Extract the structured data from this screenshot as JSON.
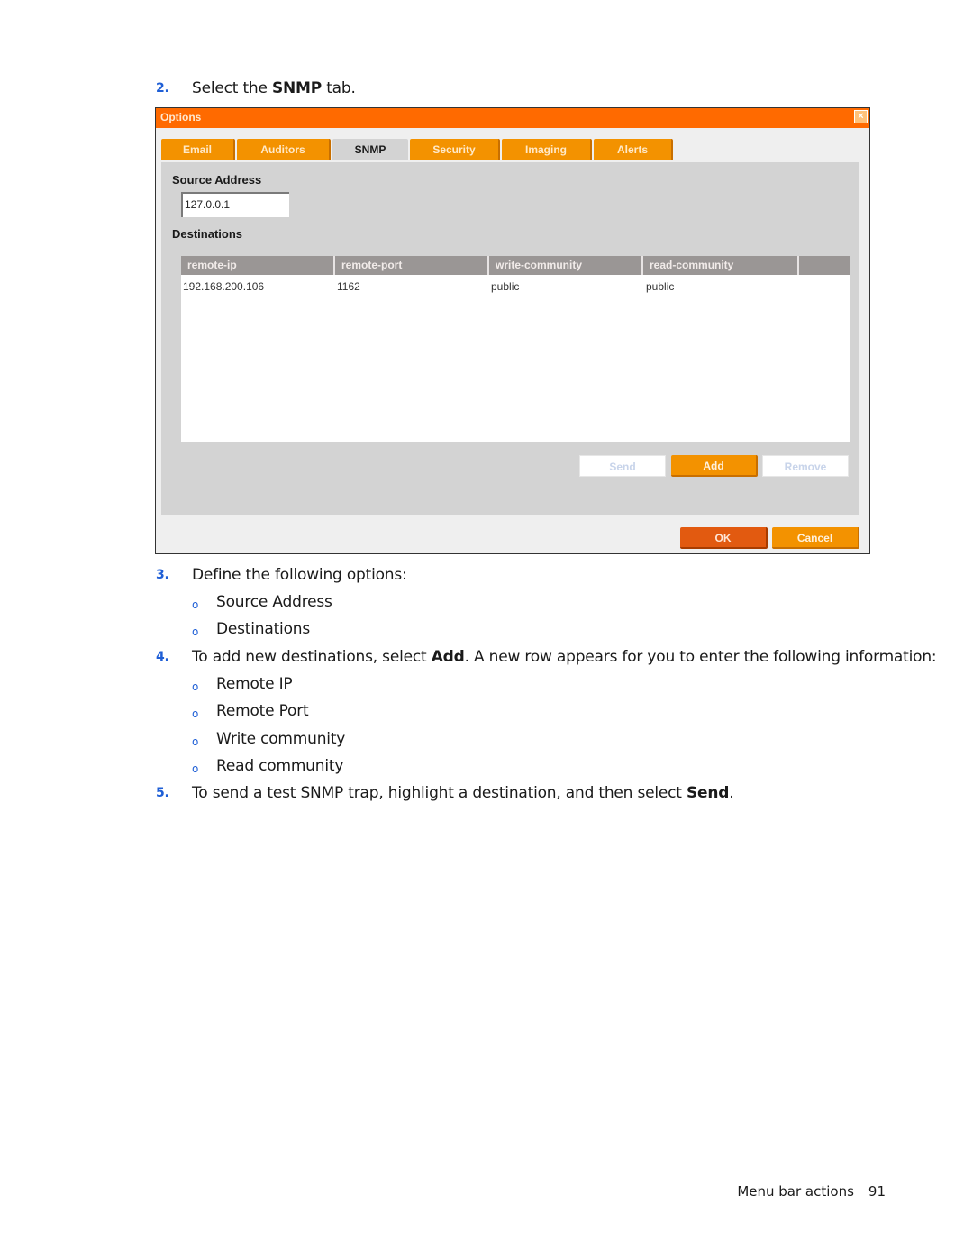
{
  "steps": {
    "s2": {
      "num": "2.",
      "pre": "Select the ",
      "bold": "SNMP",
      "post": " tab."
    },
    "s3": {
      "num": "3.",
      "text": "Define the following options:"
    },
    "s3_bullets": [
      "Source Address",
      "Destinations"
    ],
    "s4": {
      "num": "4.",
      "pre": "To add new destinations, select ",
      "bold": "Add",
      "post": ". A new row appears for you to enter the following information:"
    },
    "s4_bullets": [
      "Remote IP",
      "Remote Port",
      "Write community",
      "Read community"
    ],
    "s5": {
      "num": "5.",
      "pre": "To send a test SNMP trap,  highlight a destination, and then select ",
      "bold": "Send",
      "post": "."
    },
    "bullet_glyph": "o"
  },
  "dialog": {
    "title": "Options",
    "close_icon": "close-icon",
    "close_glyph": "×",
    "tabs": [
      {
        "label": "Email",
        "active": false
      },
      {
        "label": "Auditors",
        "active": false
      },
      {
        "label": "SNMP",
        "active": true
      },
      {
        "label": "Security",
        "active": false
      },
      {
        "label": "Imaging",
        "active": false
      },
      {
        "label": "Alerts",
        "active": false
      }
    ],
    "source_address_label": "Source Address",
    "source_address_value": "127.0.0.1",
    "destinations_label": "Destinations",
    "table": {
      "headers": [
        "remote-ip",
        "remote-port",
        "write-community",
        "read-community"
      ],
      "rows": [
        [
          "192.168.200.106",
          "1162",
          "public",
          "public"
        ]
      ]
    },
    "buttons": {
      "send": "Send",
      "add": "Add",
      "remove": "Remove",
      "ok": "OK",
      "cancel": "Cancel"
    },
    "colors": {
      "titlebar": "#ff6a00",
      "tab": "#f39200",
      "ok": "#e25a10",
      "panel": "#d3d3d3",
      "header": "#9a9695"
    }
  },
  "footer": {
    "section": "Menu bar actions",
    "page": "91"
  }
}
